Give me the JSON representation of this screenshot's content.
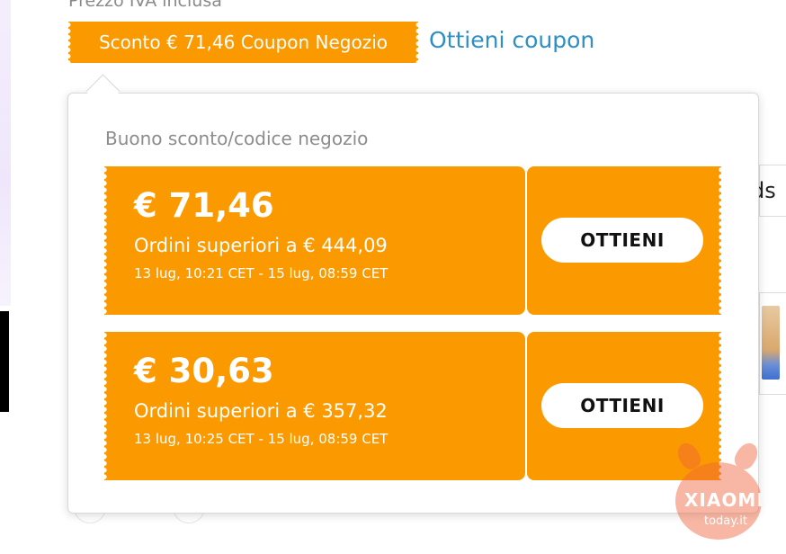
{
  "header": {
    "price_note": "Prezzo IVA inclusa",
    "discount_tag": "Sconto € 71,46 Coupon Negozio",
    "get_coupon_link": "Ottieni coupon"
  },
  "background": {
    "partial_text": "ds"
  },
  "popup": {
    "title": "Buono sconto/codice negozio",
    "coupons": [
      {
        "amount": "€ 71,46",
        "min_order": "Ordini superiori a € 444,09",
        "validity": "13 lug, 10:21 CET - 15 lug, 08:59 CET",
        "button": "OTTIENI"
      },
      {
        "amount": "€ 30,63",
        "min_order": "Ordini superiori a € 357,32",
        "validity": "13 lug, 10:25 CET - 15 lug, 08:59 CET",
        "button": "OTTIENI"
      }
    ]
  },
  "watermark": {
    "brand": "XIAOMI",
    "site": "today.it"
  },
  "colors": {
    "accent": "#fb9a00",
    "link": "#2e8fc6",
    "watermark": "#f0623a"
  }
}
